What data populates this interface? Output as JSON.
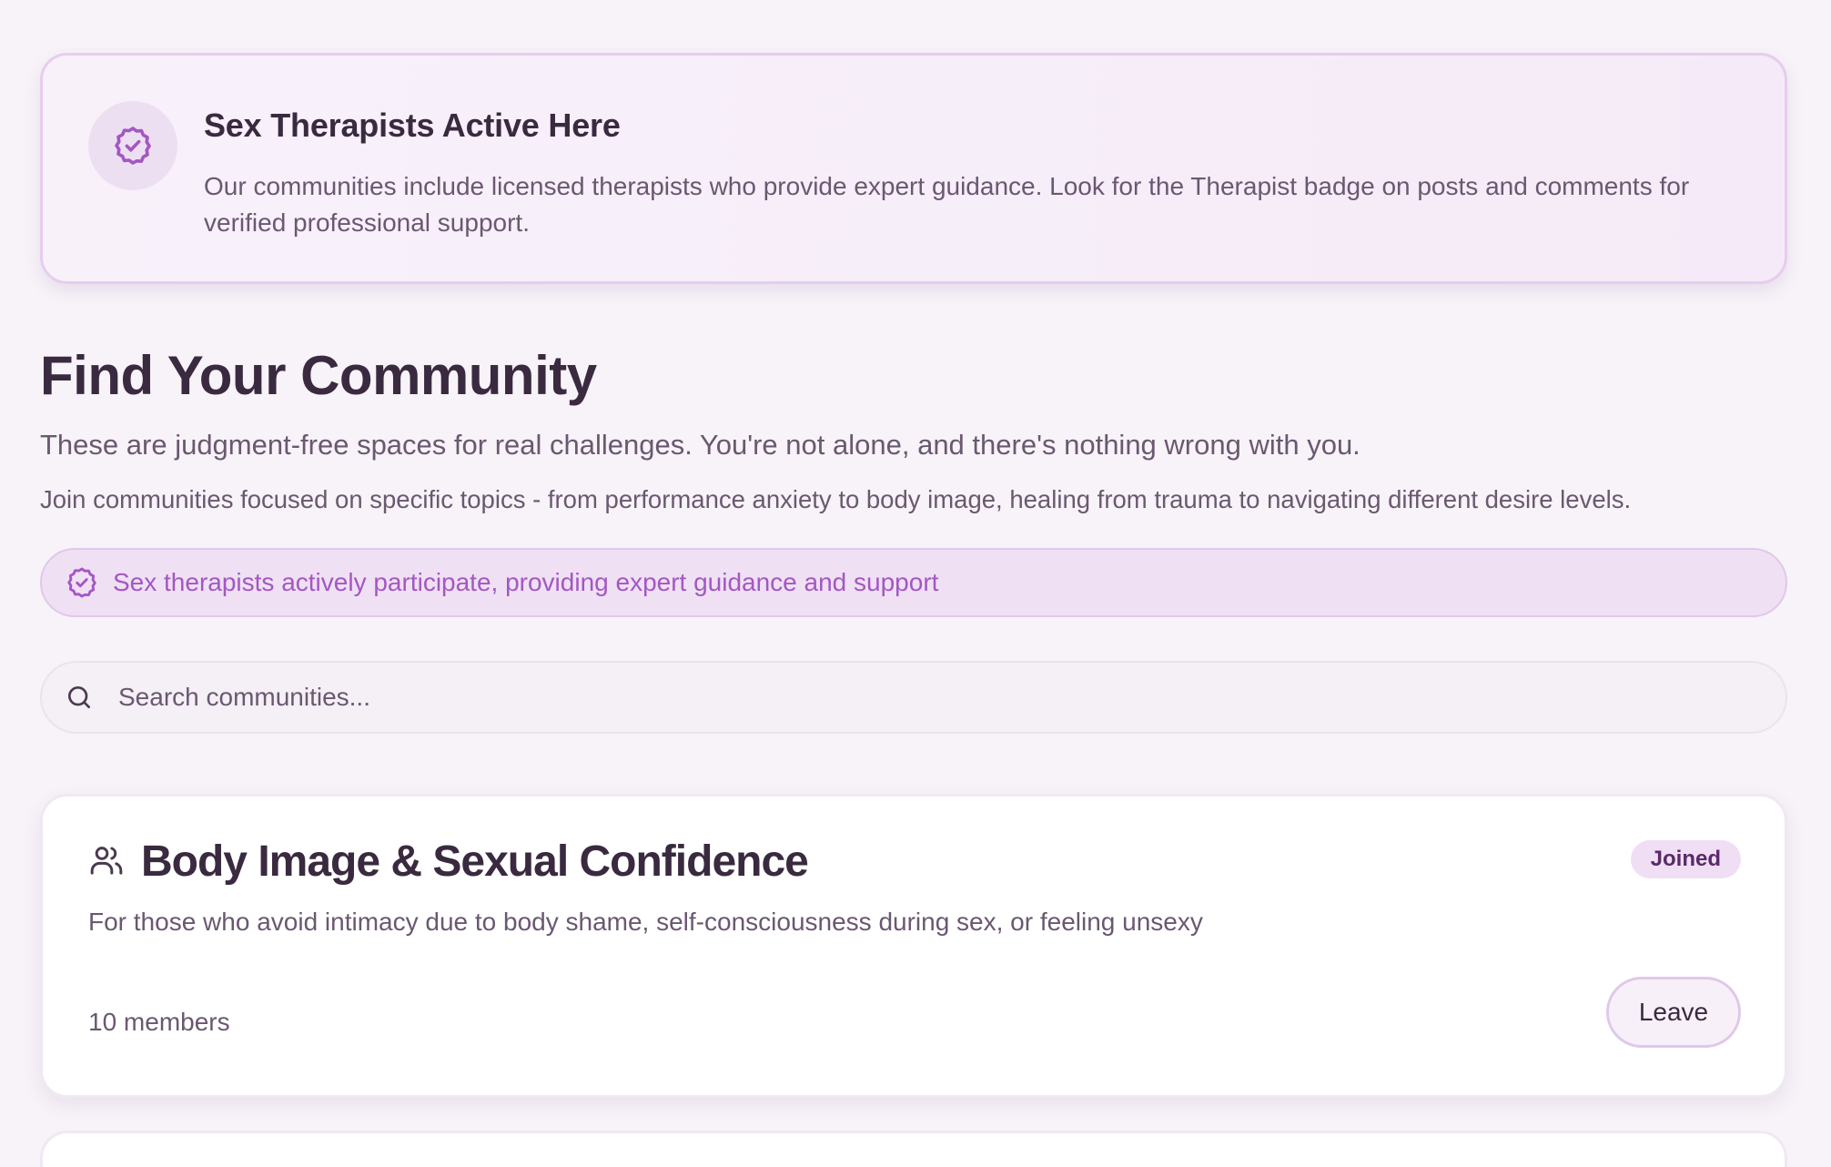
{
  "banner": {
    "title": "Sex Therapists Active Here",
    "text": "Our communities include licensed therapists who provide expert guidance. Look for the Therapist badge on posts and comments for verified professional support.",
    "icon": "verified-badge-icon"
  },
  "heading": {
    "title": "Find Your Community",
    "subtitle": "These are judgment-free spaces for real challenges. You're not alone, and there's nothing wrong with you.",
    "description": "Join communities focused on specific topics - from performance anxiety to body image, healing from trauma to navigating different desire levels."
  },
  "notice": {
    "text": "Sex therapists actively participate, providing expert guidance and support",
    "icon": "verified-badge-icon"
  },
  "search": {
    "placeholder": "Search communities...",
    "value": "",
    "icon": "search-icon"
  },
  "communities": [
    {
      "icon": "people-icon",
      "title": "Body Image & Sexual Confidence",
      "description": "For those who avoid intimacy due to body shame, self-consciousness during sex, or feeling unsexy",
      "members": "10 members",
      "badge": "Joined",
      "action_label": "Leave"
    }
  ],
  "colors": {
    "background": "#f7f3f8",
    "accent": "#a457c2",
    "text_primary": "#3a2a40",
    "text_secondary": "#6a5870",
    "border": "#e0c8ea"
  }
}
